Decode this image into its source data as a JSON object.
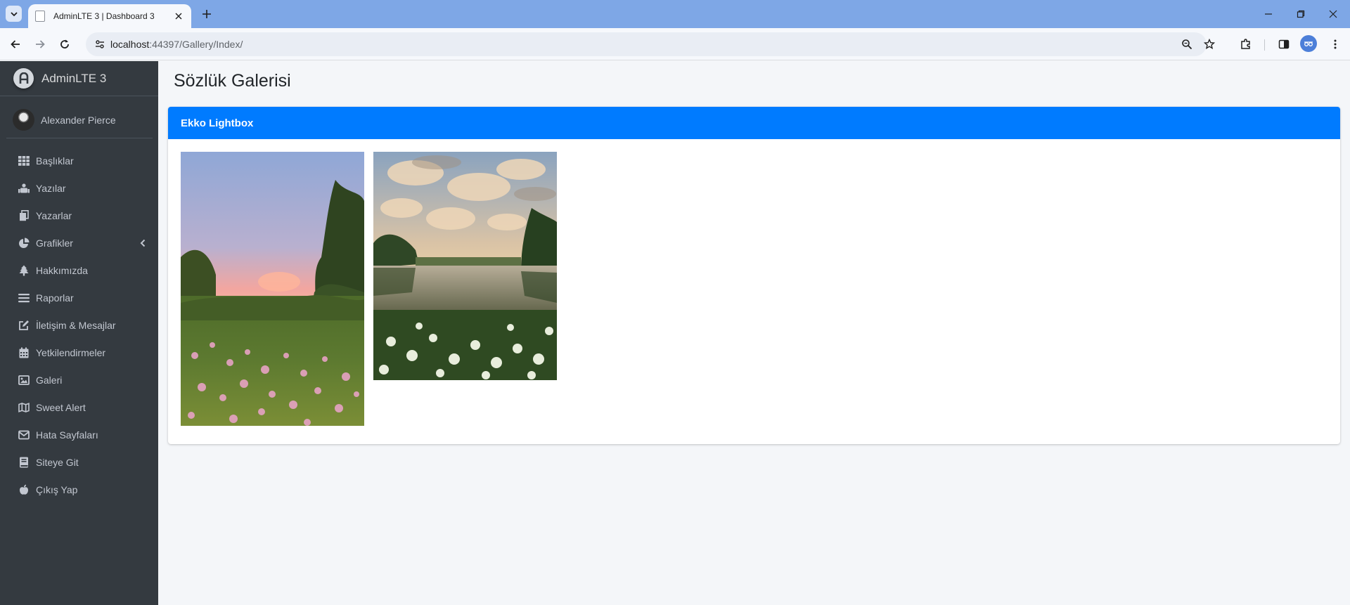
{
  "browser": {
    "tab_title": "AdminLTE 3 | Dashboard 3",
    "url_host": "localhost",
    "url_path": ":44397/Gallery/Index/"
  },
  "sidebar": {
    "brand": "AdminLTE 3",
    "user_name": "Alexander Pierce",
    "items": [
      {
        "label": "Başlıklar",
        "icon": "table-icon"
      },
      {
        "label": "Yazılar",
        "icon": "users-icon"
      },
      {
        "label": "Yazarlar",
        "icon": "copy-icon"
      },
      {
        "label": "Grafikler",
        "icon": "chart-pie-icon"
      },
      {
        "label": "Hakkımızda",
        "icon": "tree-icon"
      },
      {
        "label": "Raporlar",
        "icon": "bars-icon"
      },
      {
        "label": "İletişim & Mesajlar",
        "icon": "edit-icon"
      },
      {
        "label": "Yetkilendirmeler",
        "icon": "calendar-icon"
      },
      {
        "label": "Galeri",
        "icon": "image-icon"
      },
      {
        "label": "Sweet Alert",
        "icon": "map-icon"
      },
      {
        "label": "Hata Sayfaları",
        "icon": "envelope-icon"
      },
      {
        "label": "Siteye Git",
        "icon": "book-icon"
      },
      {
        "label": "Çıkış Yap",
        "icon": "apple-icon"
      }
    ]
  },
  "main": {
    "page_title": "Sözlük Galerisi",
    "card_title": "Ekko Lightbox"
  },
  "colors": {
    "primary": "#007bff",
    "sidebar_bg": "#343a40",
    "content_bg": "#f4f6f9"
  }
}
